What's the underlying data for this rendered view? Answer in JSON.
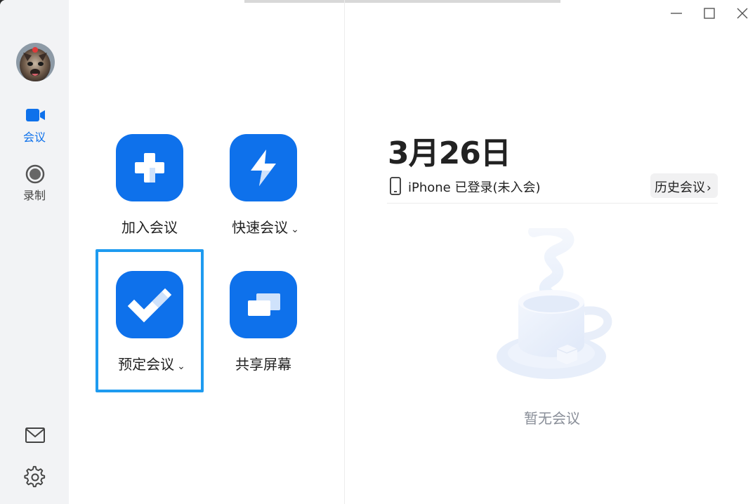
{
  "window": {
    "controls": [
      "minimize-icon",
      "maximize-icon",
      "close-icon"
    ]
  },
  "sidebar": {
    "items": [
      {
        "label": "会议",
        "icon": "video-camera-icon",
        "active": true
      },
      {
        "label": "录制",
        "icon": "record-icon",
        "active": false
      }
    ],
    "bottom_icons": [
      "mail-icon",
      "settings-gear-icon"
    ]
  },
  "actions": [
    {
      "label": "加入会议",
      "icon": "plus-icon",
      "dropdown": false
    },
    {
      "label": "快速会议",
      "icon": "lightning-icon",
      "dropdown": true
    },
    {
      "label": "预定会议",
      "icon": "checkmark-icon",
      "dropdown": true
    },
    {
      "label": "共享屏幕",
      "icon": "share-screen-icon",
      "dropdown": false
    }
  ],
  "right_panel": {
    "date": "3月26日",
    "login_status": "iPhone 已登录(未入会)",
    "history_button": "历史会议",
    "empty_text": "暂无会议"
  },
  "colors": {
    "accent": "#0e71eb",
    "focus_ring": "#1e9bf0",
    "sidebar_bg": "#f2f3f5"
  }
}
